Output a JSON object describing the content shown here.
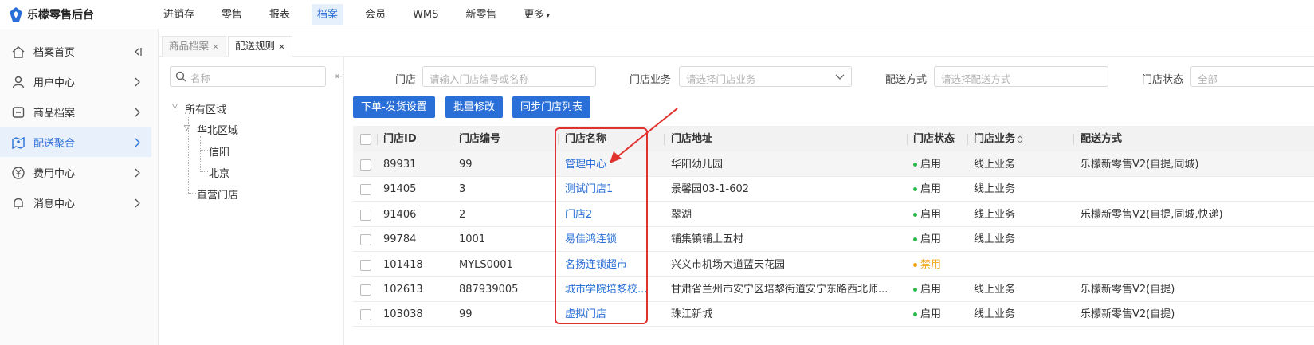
{
  "app": {
    "title": "乐檬零售后台"
  },
  "topnav": [
    {
      "label": "进销存"
    },
    {
      "label": "零售"
    },
    {
      "label": "报表"
    },
    {
      "label": "档案",
      "active": true
    },
    {
      "label": "会员"
    },
    {
      "label": "WMS"
    },
    {
      "label": "新零售"
    },
    {
      "label": "更多"
    }
  ],
  "sidebar": {
    "items": [
      {
        "label": "档案首页",
        "icon": "home-icon"
      },
      {
        "label": "用户中心",
        "icon": "user-icon"
      },
      {
        "label": "商品档案",
        "icon": "box-icon"
      },
      {
        "label": "配送聚合",
        "icon": "map-icon",
        "active": true
      },
      {
        "label": "费用中心",
        "icon": "yen-icon"
      },
      {
        "label": "消息中心",
        "icon": "bell-icon"
      }
    ]
  },
  "tabs": [
    {
      "label": "商品档案",
      "close": "×"
    },
    {
      "label": "配送规则",
      "close": "×",
      "active": true
    }
  ],
  "tree": {
    "search_placeholder": "名称",
    "collapse": "⇤",
    "nodes": {
      "root": "所有区域",
      "north": "华北区域",
      "xinyang": "信阳",
      "beijing": "北京",
      "direct": "直营门店"
    }
  },
  "filters": {
    "store_label": "门店",
    "store_placeholder": "请输入门店编号或名称",
    "business_label": "门店业务",
    "business_placeholder": "请选择门店业务",
    "delivery_label": "配送方式",
    "delivery_placeholder": "请选择配送方式",
    "status_label": "门店状态",
    "status_value": "全部"
  },
  "buttons": {
    "order_settings": "下单-发货设置",
    "batch_edit": "批量修改",
    "sync_stores": "同步门店列表"
  },
  "table": {
    "headers": {
      "id": "门店ID",
      "code": "门店编号",
      "name": "门店名称",
      "address": "门店地址",
      "status": "门店状态",
      "business": "门店业务",
      "delivery": "配送方式"
    },
    "sort_icon": "sort-icon",
    "rows": [
      {
        "id": "89931",
        "code": "99",
        "name": "管理中心",
        "address": "华阳幼儿园",
        "status": "启用",
        "business": "线上业务",
        "delivery": "乐檬新零售V2(自提,同城)"
      },
      {
        "id": "91405",
        "code": "3",
        "name": "测试门店1",
        "address": "景馨园03-1-602",
        "status": "启用",
        "business": "线上业务",
        "delivery": ""
      },
      {
        "id": "91406",
        "code": "2",
        "name": "门店2",
        "address": "翠湖",
        "status": "启用",
        "business": "线上业务",
        "delivery": "乐檬新零售V2(自提,同城,快递)"
      },
      {
        "id": "99784",
        "code": "1001",
        "name": "易佳鸿连锁",
        "address": "铺集镇铺上五村",
        "status": "启用",
        "business": "线上业务",
        "delivery": ""
      },
      {
        "id": "101418",
        "code": "MYLS0001",
        "name": "名扬连锁超市",
        "address": "兴义市机场大道蓝天花园",
        "status": "禁用",
        "business": "",
        "delivery": ""
      },
      {
        "id": "102613",
        "code": "887939005",
        "name": "城市学院培黎校...",
        "address": "甘肃省兰州市安宁区培黎街道安宁东路西北师...",
        "status": "启用",
        "business": "线上业务",
        "delivery": "乐檬新零售V2(自提)"
      },
      {
        "id": "103038",
        "code": "99",
        "name": "虚拟门店",
        "address": "珠江新城",
        "status": "启用",
        "business": "线上业务",
        "delivery": "乐檬新零售V2(自提)"
      }
    ]
  },
  "colors": {
    "accent": "#2a6fd8",
    "enabled": "#2db84d",
    "disabled": "#f5a623",
    "annotation": "#e0312d"
  }
}
